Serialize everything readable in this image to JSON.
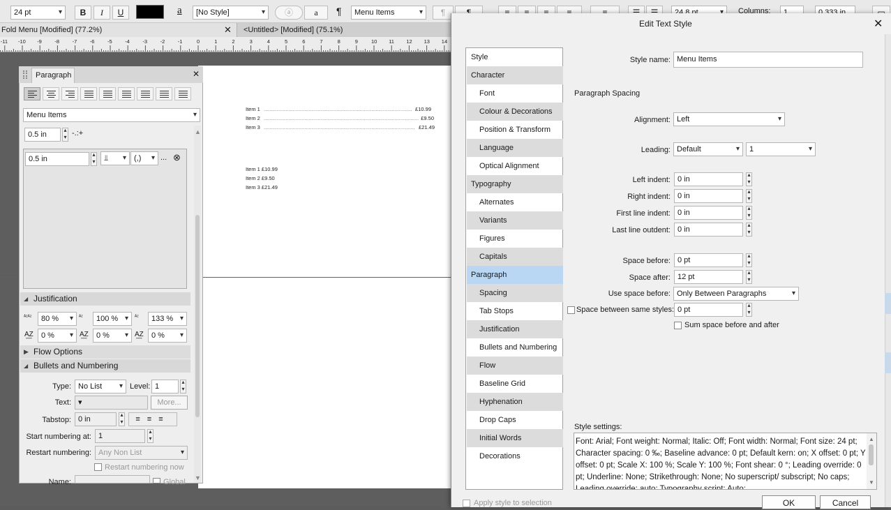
{
  "toolbar": {
    "font_size": "24 pt",
    "bold": "B",
    "italic": "I",
    "underline": "U",
    "char_style_glyph": "a",
    "char_style": "[No Style]",
    "para_glyph": "¶",
    "para_style": "Menu Items",
    "width_value": "24.8 pt",
    "columns_label": "Columns:",
    "columns_value": "1",
    "gutter_value": "0.333 in"
  },
  "tabs": [
    {
      "label": "Fold Menu [Modified] (77.2%)"
    },
    {
      "label": "<Untitled> [Modified] (75.1%)"
    }
  ],
  "ruler": {
    "ticks": [
      "-11",
      "-10",
      "-9",
      "-8",
      "-7",
      "-6",
      "-5",
      "-4",
      "-3",
      "-2",
      "-1",
      "0",
      "1",
      "2",
      "3",
      "4",
      "5",
      "6",
      "7",
      "8",
      "9",
      "10",
      "11",
      "12",
      "13",
      "14"
    ]
  },
  "canvas": {
    "menu_dotted": [
      {
        "label": "Item 1",
        "price": "£10.99"
      },
      {
        "label": "Item 2",
        "price": "£9.50"
      },
      {
        "label": "Item 3",
        "price": "£21.49"
      }
    ],
    "menu_plain": [
      "Item 1 £10.99",
      "Item 2 £9.50",
      "Item 3 £21.49"
    ]
  },
  "paragraph_panel": {
    "title": "Paragraph",
    "style": "Menu Items",
    "indent": "0.5 in",
    "tab_position": "0.5 in",
    "tab_char": "(,)",
    "tab_more": "...",
    "justification": {
      "title": "Justification",
      "word_spacing": "80 %",
      "letter_min": "100 %",
      "letter_max": "133 %",
      "row2_a": "0 %",
      "row2_b": "0 %",
      "row2_c": "0 %"
    },
    "flow_options": "Flow Options",
    "bullets": {
      "title": "Bullets and Numbering",
      "type_label": "Type:",
      "type_value": "No List",
      "level_label": "Level:",
      "level_value": "1",
      "text_label": "Text:",
      "text_value": "▾",
      "more_button": "More...",
      "tabstop_label": "Tabstop:",
      "tabstop_value": "0 in",
      "start_label": "Start numbering at:",
      "start_value": "1",
      "restart_label": "Restart numbering:",
      "restart_value": "Any Non List",
      "restart_checkbox": "Restart numbering now",
      "name_label": "Name:",
      "global_label": "Global"
    }
  },
  "dialog": {
    "title": "Edit Text Style",
    "nav": [
      {
        "label": "Style",
        "level": 1
      },
      {
        "label": "Character",
        "level": 1
      },
      {
        "label": "Font",
        "level": 2
      },
      {
        "label": "Colour & Decorations",
        "level": 2
      },
      {
        "label": "Position & Transform",
        "level": 2
      },
      {
        "label": "Language",
        "level": 2
      },
      {
        "label": "Optical Alignment",
        "level": 2
      },
      {
        "label": "Typography",
        "level": 1
      },
      {
        "label": "Alternates",
        "level": 2
      },
      {
        "label": "Variants",
        "level": 2
      },
      {
        "label": "Figures",
        "level": 2
      },
      {
        "label": "Capitals",
        "level": 2
      },
      {
        "label": "Paragraph",
        "level": 1,
        "selected": true
      },
      {
        "label": "Spacing",
        "level": 2
      },
      {
        "label": "Tab Stops",
        "level": 2
      },
      {
        "label": "Justification",
        "level": 2
      },
      {
        "label": "Bullets and Numbering",
        "level": 2
      },
      {
        "label": "Flow",
        "level": 2
      },
      {
        "label": "Baseline Grid",
        "level": 2
      },
      {
        "label": "Hyphenation",
        "level": 2
      },
      {
        "label": "Drop Caps",
        "level": 2
      },
      {
        "label": "Initial Words",
        "level": 2
      },
      {
        "label": "Decorations",
        "level": 2
      }
    ],
    "style_name_label": "Style name:",
    "style_name_value": "Menu Items",
    "section_title": "Paragraph Spacing",
    "alignment_label": "Alignment:",
    "alignment_value": "Left",
    "leading_label": "Leading:",
    "leading_value": "Default",
    "leading_multiplier": "1",
    "left_indent_label": "Left indent:",
    "left_indent_value": "0 in",
    "right_indent_label": "Right indent:",
    "right_indent_value": "0 in",
    "first_line_label": "First line indent:",
    "first_line_value": "0 in",
    "last_line_label": "Last line outdent:",
    "last_line_value": "0 in",
    "space_before_label": "Space before:",
    "space_before_value": "0 pt",
    "space_after_label": "Space after:",
    "space_after_value": "12 pt",
    "use_space_label": "Use space before:",
    "use_space_value": "Only Between Paragraphs",
    "same_styles_label": "Space between same styles:",
    "same_styles_value": "0 pt",
    "sum_space_label": "Sum space before and after",
    "settings_label": "Style settings:",
    "settings_text": "Font: Arial; Font weight: Normal; Italic: Off; Font width: Normal; Font size: 24 pt; Character spacing: 0 ‰; Baseline advance: 0 pt; Default kern: on; X offset: 0 pt; Y offset: 0 pt; Scale X: 100 %; Scale Y: 100 %; Font shear: 0 °; Leading override: 0 pt; Underline: None; Strikethrough: None; No superscript/ subscript; No caps; Leading override: auto; Typography script: Auto;",
    "apply_label": "Apply style to selection",
    "ok_label": "OK",
    "cancel_label": "Cancel"
  }
}
